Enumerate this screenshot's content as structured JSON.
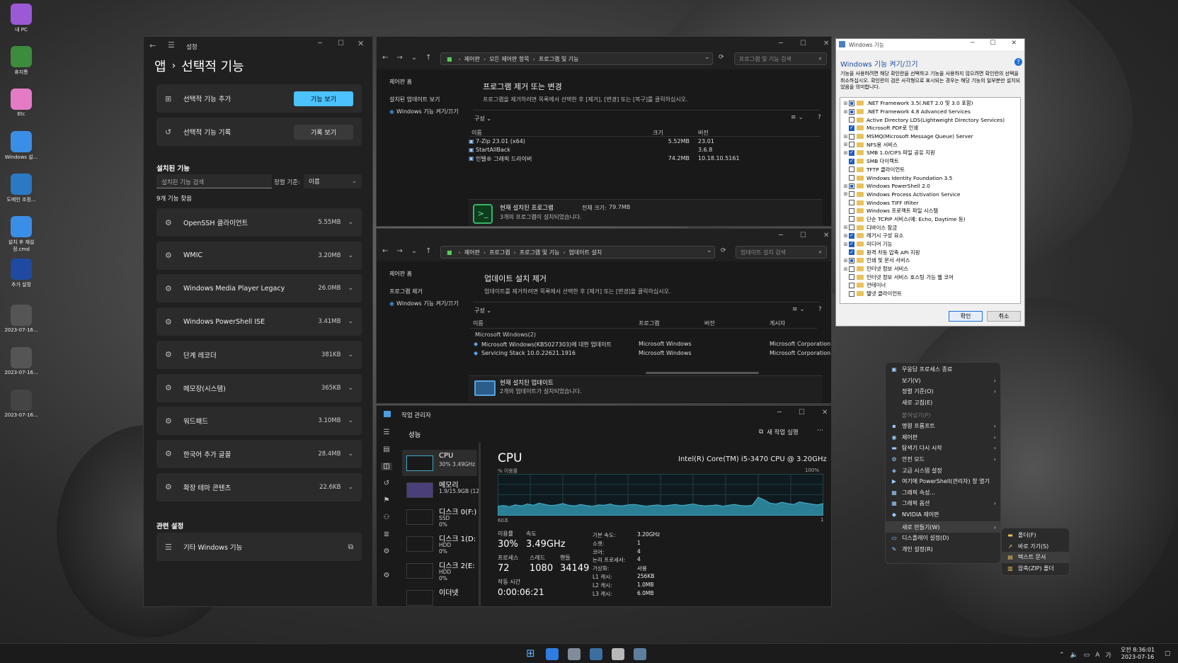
{
  "desktop": {
    "icons": [
      {
        "label": "내 PC",
        "color": "#9b59d6"
      },
      {
        "label": "휴지통",
        "color": "#3d8b3d"
      },
      {
        "label": "Etc",
        "color": "#e57bc5"
      },
      {
        "label": "Windows 설...",
        "color": "#3b8ee6"
      },
      {
        "label": "도메인 조정...",
        "color": "#2b79c2"
      },
      {
        "label": "설치 후 재설정.cmd",
        "color": "#3b8ee6"
      },
      {
        "label": "추가 설정",
        "color": "#1f4aa0"
      },
      {
        "label": "2023-07-16...",
        "color": "#555"
      },
      {
        "label": "2023-07-16...",
        "color": "#555"
      },
      {
        "label": "2023-07-16...",
        "color": "#444"
      }
    ]
  },
  "settings": {
    "app_title": "설정",
    "breadcrumb_parent": "앱",
    "breadcrumb_sep": "›",
    "page_title": "선택적 기능",
    "add_feature_label": "선택적 기능 추가",
    "add_feature_button": "기능 보기",
    "history_label": "선택적 기능 기록",
    "history_button": "기록 보기",
    "installed_heading": "설치된 기능",
    "search_placeholder": "설치된 기능 검색",
    "sort_label": "정렬 기준:",
    "sort_value": "이름",
    "count_text": "9개 기능 찾음",
    "features": [
      {
        "name": "OpenSSH 클라이언트",
        "size": "5.55MB"
      },
      {
        "name": "WMIC",
        "size": "3.20MB"
      },
      {
        "name": "Windows Media Player Legacy",
        "size": "26.0MB"
      },
      {
        "name": "Windows PowerShell ISE",
        "size": "3.41MB"
      },
      {
        "name": "단계 레코더",
        "size": "381KB"
      },
      {
        "name": "메모장(시스템)",
        "size": "365KB"
      },
      {
        "name": "워드패드",
        "size": "3.10MB"
      },
      {
        "name": "한국어 추가 글꼴",
        "size": "28.4MB"
      },
      {
        "name": "확장 테마 콘텐츠",
        "size": "22.6KB"
      }
    ],
    "related_heading": "관련 설정",
    "related_item": "기타 Windows 기능"
  },
  "programs": {
    "address": [
      "제어판",
      "모든 제어판 항목",
      "프로그램 및 기능"
    ],
    "search_placeholder": "프로그램 및 기능 검색",
    "side": [
      "제어판 홈",
      "설치된 업데이트 보기",
      "Windows 기능 켜기/끄기"
    ],
    "title": "프로그램 제거 또는 변경",
    "desc": "프로그램을 제거하려면 목록에서 선택한 후 [제거], [변경] 또는 [복구]를 클릭하십시오.",
    "organize": "구성 ⌄",
    "columns": [
      "이름",
      "크기",
      "버전"
    ],
    "rows": [
      {
        "name": "7-Zip 23.01 (x64)",
        "size": "5.52MB",
        "version": "23.01"
      },
      {
        "name": "StartAllBack",
        "size": "",
        "version": "3.6.8"
      },
      {
        "name": "인텔® 그래픽 드라이버",
        "size": "74.2MB",
        "version": "10.18.10.5161"
      }
    ],
    "footer_title": "현재 설치된 프로그램",
    "footer_total_label": "전체 크기:",
    "footer_total": "79.7MB",
    "footer_count": "3개의 프로그램이 설치되었습니다."
  },
  "updates": {
    "address": [
      "제어판",
      "프로그램",
      "프로그램 및 기능",
      "업데이트 설치"
    ],
    "search_placeholder": "업데이트 설치 검색",
    "side": [
      "제어판 홈",
      "프로그램 제거",
      "Windows 기능 켜기/끄기"
    ],
    "title": "업데이트 설치 제거",
    "desc": "업데이트를 제거하려면 목록에서 선택한 후 [제거] 또는 [변경]을 클릭하십시오.",
    "organize": "구성 ⌄",
    "columns": [
      "이름",
      "프로그램",
      "버전",
      "게시자"
    ],
    "group": "Microsoft Windows(2)",
    "rows": [
      {
        "name": "Microsoft Windows(KB5027303)에 대한 업데이트",
        "program": "Microsoft Windows",
        "publisher": "Microsoft Corporation"
      },
      {
        "name": "Servicing Stack 10.0.22621.1916",
        "program": "Microsoft Windows",
        "publisher": "Microsoft Corporation"
      }
    ],
    "footer_title": "현재 설치된 업데이트",
    "footer_count": "2개의 업데이트가 설치되었습니다."
  },
  "taskmgr": {
    "title": "작업 관리자",
    "section": "성능",
    "new_task": "새 작업 실행",
    "items": [
      {
        "name": "CPU",
        "sub": "30% 3.49GHz",
        "sub2": ""
      },
      {
        "name": "메모리",
        "sub": "1.9/15.9GB (12",
        "sub2": ""
      },
      {
        "name": "디스크 0(F:)",
        "sub": "SSD",
        "sub2": "0%"
      },
      {
        "name": "디스크 1(D:",
        "sub": "HDD",
        "sub2": "0%"
      },
      {
        "name": "디스크 2(E:",
        "sub": "HDD",
        "sub2": "0%"
      },
      {
        "name": "이더넷",
        "sub": "",
        "sub2": ""
      }
    ],
    "cpu_title": "CPU",
    "cpu_model": "Intel(R) Core(TM) i5-3470 CPU @ 3.20GHz",
    "usage_label": "% 이용률",
    "usage_max": "100%",
    "axis_left": "60초",
    "axis_right": "1",
    "stats": {
      "util_label": "이용률",
      "util": "30%",
      "speed_label": "속도",
      "speed": "3.49GHz",
      "proc_label": "프로세스",
      "proc": "72",
      "threads_label": "스레드",
      "threads": "1080",
      "handles_label": "핸들",
      "handles": "34149",
      "uptime_label": "작동 시간",
      "uptime": "0:00:06:21"
    },
    "specs": [
      [
        "기본 속도:",
        "3.20GHz"
      ],
      [
        "소켓:",
        "1"
      ],
      [
        "코어:",
        "4"
      ],
      [
        "논리 프로세서:",
        "4"
      ],
      [
        "가상화:",
        "사용"
      ],
      [
        "L1 캐시:",
        "256KB"
      ],
      [
        "L2 캐시:",
        "1.0MB"
      ],
      [
        "L3 캐시:",
        "6.0MB"
      ]
    ],
    "cpu_graph": [
      22,
      24,
      21,
      26,
      23,
      28,
      25,
      30,
      27,
      24,
      26,
      29,
      25,
      23,
      27,
      24,
      22,
      26,
      25,
      28,
      24,
      23,
      26,
      27,
      25,
      22,
      24,
      26,
      23,
      25,
      27,
      24,
      26,
      28,
      25,
      23,
      24,
      26,
      22,
      25,
      27,
      24,
      23,
      25,
      44,
      38,
      30,
      28,
      32,
      29,
      27,
      33,
      30,
      28,
      26,
      29
    ]
  },
  "winfeat": {
    "title": "Windows 기능",
    "heading": "Windows 기능 켜기/끄기",
    "desc": "기능을 사용하려면 해당 확인란을 선택하고 기능을 사용하지 않으려면 확인란의 선택을 취소하십시오. 확인란이 검은 사각형으로 표시되는 경우는 해당 기능의 일부분만 설치되었음을 의미합니다.",
    "items": [
      {
        "label": ".NET Framework 3.5(.NET 2.0 및 3.0 포함)",
        "exp": "+",
        "state": "part"
      },
      {
        "label": ".NET Framework 4.8 Advanced Services",
        "exp": "+",
        "state": "part"
      },
      {
        "label": "Active Directory LDS(Lightweight Directory Services)",
        "exp": "",
        "state": "off"
      },
      {
        "label": "Microsoft PDF로 인쇄",
        "exp": "",
        "state": "on"
      },
      {
        "label": "MSMQ(Microsoft Message Queue) Server",
        "exp": "+",
        "state": "off"
      },
      {
        "label": "NFS용 서비스",
        "exp": "+",
        "state": "off"
      },
      {
        "label": "SMB 1.0/CIFS 파일 공유 지원",
        "exp": "+",
        "state": "on"
      },
      {
        "label": "SMB 다이렉트",
        "exp": "",
        "state": "on"
      },
      {
        "label": "TFTP 클라이언트",
        "exp": "",
        "state": "off"
      },
      {
        "label": "Windows Identity Foundation 3.5",
        "exp": "",
        "state": "off"
      },
      {
        "label": "Windows PowerShell 2.0",
        "exp": "+",
        "state": "part"
      },
      {
        "label": "Windows Process Activation Service",
        "exp": "+",
        "state": "off"
      },
      {
        "label": "Windows TIFF IFilter",
        "exp": "",
        "state": "off"
      },
      {
        "label": "Windows 프로젝트 파일 시스템",
        "exp": "",
        "state": "off"
      },
      {
        "label": "단순 TCPIP 서비스(예: Echo, Daytime 등)",
        "exp": "",
        "state": "off"
      },
      {
        "label": "디바이스 잠금",
        "exp": "+",
        "state": "off"
      },
      {
        "label": "레거시 구성 요소",
        "exp": "+",
        "state": "on"
      },
      {
        "label": "미디어 기능",
        "exp": "+",
        "state": "on"
      },
      {
        "label": "원격 차등 압축 API 지원",
        "exp": "",
        "state": "on"
      },
      {
        "label": "인쇄 및 문서 서비스",
        "exp": "+",
        "state": "part"
      },
      {
        "label": "인터넷 정보 서비스",
        "exp": "+",
        "state": "off"
      },
      {
        "label": "인터넷 정보 서비스 호스팅 가능 웹 코어",
        "exp": "",
        "state": "off"
      },
      {
        "label": "컨테이너",
        "exp": "",
        "state": "off"
      },
      {
        "label": "텔넷 클라이언트",
        "exp": "",
        "state": "off"
      }
    ],
    "ok": "확인",
    "cancel": "취소"
  },
  "context_menu": {
    "items": [
      {
        "label": "무응답 프로세스 종료",
        "icon": "kill-icon",
        "glyph": "▣",
        "arrow": ""
      },
      {
        "label": "보기(V)",
        "icon": "",
        "glyph": "",
        "arrow": "›"
      },
      {
        "label": "정렬 기준(O)",
        "icon": "",
        "glyph": "",
        "arrow": "›"
      },
      {
        "label": "새로 고침(E)",
        "icon": "",
        "glyph": "",
        "arrow": ""
      },
      {
        "label": "붙여넣기(P)",
        "icon": "",
        "glyph": "",
        "arrow": "",
        "disabled": true
      },
      {
        "label": "명령 프롬프트",
        "icon": "cmd-icon",
        "glyph": "▪",
        "arrow": "›"
      },
      {
        "label": "제어판",
        "icon": "control-panel-icon",
        "glyph": "◉",
        "arrow": "›"
      },
      {
        "label": "탐색기 다시 시작",
        "icon": "folder-icon",
        "glyph": "▬",
        "arrow": "›"
      },
      {
        "label": "안전 모드",
        "icon": "gear-icon",
        "glyph": "⚙",
        "arrow": "›"
      },
      {
        "label": "고급 시스템 설정",
        "icon": "system-icon",
        "glyph": "◈",
        "arrow": ""
      },
      {
        "label": "여기에 PowerShell(관리자) 창 열기",
        "icon": "powershell-icon",
        "glyph": "▶",
        "arrow": ""
      },
      {
        "label": "그래픽 속성...",
        "icon": "graphics-icon",
        "glyph": "▦",
        "arrow": ""
      },
      {
        "label": "그래픽 옵션",
        "icon": "graphics-options-icon",
        "glyph": "▦",
        "arrow": "›"
      },
      {
        "label": "NVIDIA 제어판",
        "icon": "nvidia-icon",
        "glyph": "◆",
        "arrow": ""
      },
      {
        "label": "새로 만들기(W)",
        "icon": "",
        "glyph": "",
        "arrow": "›",
        "highlight": true
      },
      {
        "label": "디스플레이 설정(D)",
        "icon": "display-icon",
        "glyph": "▭",
        "arrow": ""
      },
      {
        "label": "개인 설정(R)",
        "icon": "brush-icon",
        "glyph": "✎",
        "arrow": ""
      }
    ],
    "submenu": [
      {
        "label": "폴더(F)",
        "icon": "folder-icon",
        "glyph": "▬"
      },
      {
        "label": "바로 가기(S)",
        "icon": "shortcut-icon",
        "glyph": "↗"
      },
      {
        "label": "텍스트 문서",
        "icon": "text-doc-icon",
        "glyph": "▤"
      },
      {
        "label": "압축(ZIP) 폴더",
        "icon": "zip-icon",
        "glyph": "▥"
      }
    ]
  },
  "taskbar": {
    "ampm_time": "오전 8:36:01",
    "date": "2023-07-16",
    "tray_lang": "A",
    "tray_ime": "가"
  }
}
